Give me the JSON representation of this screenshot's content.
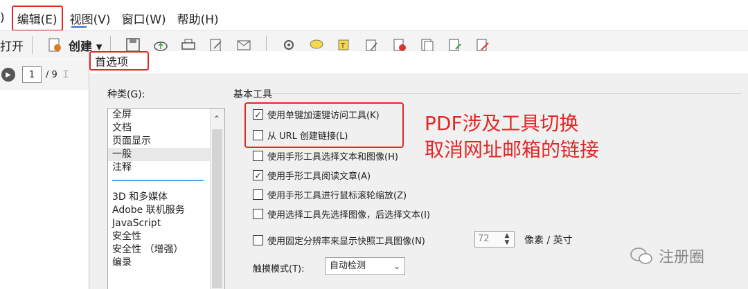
{
  "menubar": {
    "partial": ")",
    "items": [
      "编辑(E)",
      "视图(V)",
      "窗口(W)",
      "帮助(H)"
    ]
  },
  "toolbar": {
    "open_label": "打开",
    "create_label": "创建 ▾"
  },
  "nav": {
    "page_current": "1",
    "page_total": "/ 9"
  },
  "dialog": {
    "title": "首选项",
    "category_label": "种类(G):",
    "categories_top": [
      "全屏",
      "文档",
      "页面显示",
      "一般",
      "注释"
    ],
    "categories_bottom": [
      "3D 和多媒体",
      "Adobe 联机服务",
      "JavaScript",
      "安全性",
      "安全性 （增强）",
      "编录"
    ],
    "group_title": "基本工具",
    "options": [
      {
        "label": "使用单键加速键访问工具(K)",
        "checked": true
      },
      {
        "label": "从 URL 创建链接(L)",
        "checked": false
      },
      {
        "label": "使用手形工具选择文本和图像(H)",
        "checked": false
      },
      {
        "label": "使用手形工具阅读文章(A)",
        "checked": true
      },
      {
        "label": "使用手形工具进行鼠标滚轮缩放(Z)",
        "checked": false
      },
      {
        "label": "使用选择工具先选择图像，后选择文本(I)",
        "checked": false
      },
      {
        "label": "使用固定分辨率来显示快照工具图像(N)",
        "checked": false
      }
    ],
    "resolution_value": "72",
    "resolution_unit": "像素 / 英寸",
    "touch_label": "触摸模式(T):",
    "touch_value": "自动检测"
  },
  "annotation": {
    "line1": "PDF涉及工具切换",
    "line2": "取消网址邮箱的链接"
  },
  "watermark": "注册圈",
  "colors": {
    "highlight": "#e32626",
    "accent": "#2a6fd6"
  }
}
